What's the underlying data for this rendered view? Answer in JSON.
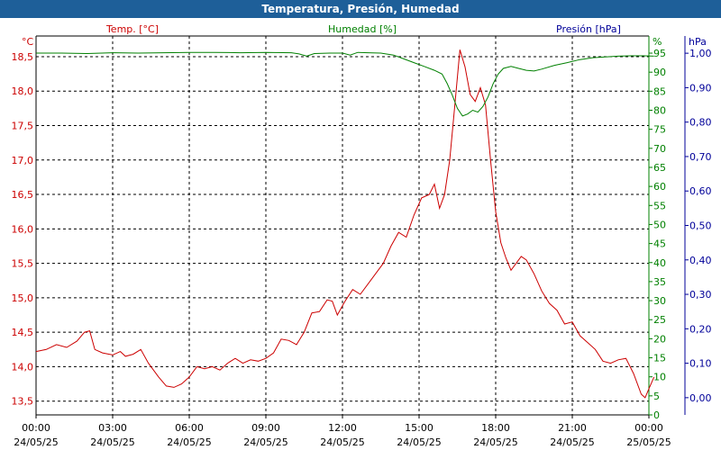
{
  "window": {
    "title": "Temperatura, Presión, Humedad"
  },
  "colors": {
    "temp": "#cc0000",
    "hum": "#008000",
    "pres": "#000099",
    "axis": "#000000",
    "grid": "#000000"
  },
  "chart_data": {
    "type": "line",
    "title": "Temperatura, Presión, Humedad",
    "grid": true,
    "x_ticks": [
      {
        "time": "00:00",
        "date": "24/05/25"
      },
      {
        "time": "03:00",
        "date": "24/05/25"
      },
      {
        "time": "06:00",
        "date": "24/05/25"
      },
      {
        "time": "09:00",
        "date": "24/05/25"
      },
      {
        "time": "12:00",
        "date": "24/05/25"
      },
      {
        "time": "15:00",
        "date": "24/05/25"
      },
      {
        "time": "18:00",
        "date": "24/05/25"
      },
      {
        "time": "21:00",
        "date": "24/05/25"
      },
      {
        "time": "00:00",
        "date": "25/05/25"
      }
    ],
    "axes": {
      "temp": {
        "label": "Temp. [°C]",
        "unit": "°C",
        "range": [
          13.3,
          18.8
        ],
        "ticks": [
          "13,5",
          "14,0",
          "14,5",
          "15,0",
          "15,5",
          "16,0",
          "16,5",
          "17,0",
          "17,5",
          "18,0",
          "18,5"
        ]
      },
      "hum": {
        "label": "Humedad [%]",
        "unit": "%",
        "range": [
          0,
          99.5
        ],
        "ticks": [
          "0",
          "5",
          "10",
          "15",
          "20",
          "25",
          "30",
          "35",
          "40",
          "45",
          "50",
          "55",
          "60",
          "65",
          "70",
          "75",
          "80",
          "85",
          "90",
          "95"
        ]
      },
      "pres": {
        "label": "Presión [hPa]",
        "unit": "hPa",
        "range": [
          -0.05,
          1.05
        ],
        "ticks": [
          "0,00",
          "0,10",
          "0,20",
          "0,30",
          "0,40",
          "0,50",
          "0,60",
          "0,70",
          "0,80",
          "0,90",
          "1,00"
        ]
      }
    },
    "series": [
      {
        "name": "Temp. [°C]",
        "axis": "temp",
        "points": [
          [
            0,
            14.22
          ],
          [
            0.4,
            14.25
          ],
          [
            0.8,
            14.32
          ],
          [
            1.2,
            14.28
          ],
          [
            1.6,
            14.37
          ],
          [
            1.9,
            14.5
          ],
          [
            2.1,
            14.52
          ],
          [
            2.3,
            14.25
          ],
          [
            2.6,
            14.2
          ],
          [
            3.0,
            14.17
          ],
          [
            3.3,
            14.22
          ],
          [
            3.5,
            14.15
          ],
          [
            3.8,
            14.18
          ],
          [
            4.1,
            14.25
          ],
          [
            4.4,
            14.05
          ],
          [
            4.8,
            13.85
          ],
          [
            5.1,
            13.72
          ],
          [
            5.4,
            13.7
          ],
          [
            5.7,
            13.75
          ],
          [
            6.0,
            13.85
          ],
          [
            6.3,
            14.0
          ],
          [
            6.6,
            13.97
          ],
          [
            6.9,
            14.0
          ],
          [
            7.2,
            13.95
          ],
          [
            7.5,
            14.05
          ],
          [
            7.8,
            14.12
          ],
          [
            8.1,
            14.05
          ],
          [
            8.4,
            14.1
          ],
          [
            8.7,
            14.08
          ],
          [
            9.0,
            14.12
          ],
          [
            9.3,
            14.2
          ],
          [
            9.6,
            14.4
          ],
          [
            9.9,
            14.38
          ],
          [
            10.2,
            14.32
          ],
          [
            10.5,
            14.5
          ],
          [
            10.8,
            14.78
          ],
          [
            11.1,
            14.8
          ],
          [
            11.4,
            14.97
          ],
          [
            11.6,
            14.95
          ],
          [
            11.8,
            14.75
          ],
          [
            12.1,
            14.95
          ],
          [
            12.4,
            15.12
          ],
          [
            12.7,
            15.05
          ],
          [
            13.0,
            15.2
          ],
          [
            13.3,
            15.35
          ],
          [
            13.6,
            15.5
          ],
          [
            13.9,
            15.75
          ],
          [
            14.2,
            15.95
          ],
          [
            14.5,
            15.88
          ],
          [
            14.8,
            16.2
          ],
          [
            15.1,
            16.45
          ],
          [
            15.4,
            16.5
          ],
          [
            15.6,
            16.65
          ],
          [
            15.8,
            16.3
          ],
          [
            16.0,
            16.5
          ],
          [
            16.2,
            17.0
          ],
          [
            16.4,
            17.8
          ],
          [
            16.6,
            18.6
          ],
          [
            16.8,
            18.35
          ],
          [
            17.0,
            17.95
          ],
          [
            17.2,
            17.85
          ],
          [
            17.4,
            18.05
          ],
          [
            17.6,
            17.8
          ],
          [
            17.8,
            17.0
          ],
          [
            18.0,
            16.25
          ],
          [
            18.2,
            15.8
          ],
          [
            18.4,
            15.58
          ],
          [
            18.6,
            15.4
          ],
          [
            18.8,
            15.5
          ],
          [
            19.0,
            15.6
          ],
          [
            19.2,
            15.55
          ],
          [
            19.5,
            15.35
          ],
          [
            19.8,
            15.1
          ],
          [
            20.1,
            14.92
          ],
          [
            20.4,
            14.82
          ],
          [
            20.7,
            14.62
          ],
          [
            21.0,
            14.65
          ],
          [
            21.3,
            14.45
          ],
          [
            21.6,
            14.35
          ],
          [
            21.9,
            14.25
          ],
          [
            22.2,
            14.08
          ],
          [
            22.5,
            14.05
          ],
          [
            22.8,
            14.1
          ],
          [
            23.1,
            14.12
          ],
          [
            23.4,
            13.9
          ],
          [
            23.7,
            13.6
          ],
          [
            23.85,
            13.55
          ],
          [
            24.0,
            13.68
          ],
          [
            24.2,
            13.85
          ]
        ]
      },
      {
        "name": "Humedad [%]",
        "axis": "hum",
        "points": [
          [
            0,
            95.0
          ],
          [
            1.0,
            95.0
          ],
          [
            2.0,
            94.9
          ],
          [
            3.0,
            95.1
          ],
          [
            4.0,
            95.0
          ],
          [
            5.0,
            95.1
          ],
          [
            6.0,
            95.2
          ],
          [
            7.0,
            95.2
          ],
          [
            8.0,
            95.1
          ],
          [
            9.0,
            95.2
          ],
          [
            10.0,
            95.1
          ],
          [
            10.3,
            94.8
          ],
          [
            10.6,
            94.2
          ],
          [
            10.9,
            94.9
          ],
          [
            11.5,
            95.0
          ],
          [
            12.0,
            95.0
          ],
          [
            12.3,
            94.5
          ],
          [
            12.6,
            95.2
          ],
          [
            13.0,
            95.1
          ],
          [
            13.5,
            95.0
          ],
          [
            14.0,
            94.5
          ],
          [
            14.4,
            93.5
          ],
          [
            14.8,
            92.5
          ],
          [
            15.2,
            91.5
          ],
          [
            15.6,
            90.5
          ],
          [
            15.9,
            89.5
          ],
          [
            16.1,
            87.0
          ],
          [
            16.3,
            84.0
          ],
          [
            16.5,
            80.5
          ],
          [
            16.7,
            78.5
          ],
          [
            16.9,
            79.0
          ],
          [
            17.1,
            80.0
          ],
          [
            17.3,
            79.5
          ],
          [
            17.5,
            81.0
          ],
          [
            17.7,
            83.5
          ],
          [
            17.9,
            87.0
          ],
          [
            18.1,
            89.5
          ],
          [
            18.3,
            91.0
          ],
          [
            18.6,
            91.5
          ],
          [
            18.9,
            91.0
          ],
          [
            19.2,
            90.5
          ],
          [
            19.5,
            90.3
          ],
          [
            19.8,
            90.8
          ],
          [
            20.3,
            91.8
          ],
          [
            20.8,
            92.5
          ],
          [
            21.3,
            93.3
          ],
          [
            21.8,
            93.8
          ],
          [
            22.3,
            94.0
          ],
          [
            22.8,
            94.2
          ],
          [
            23.3,
            94.3
          ],
          [
            23.8,
            94.3
          ],
          [
            24.2,
            94.2
          ]
        ]
      }
    ]
  }
}
